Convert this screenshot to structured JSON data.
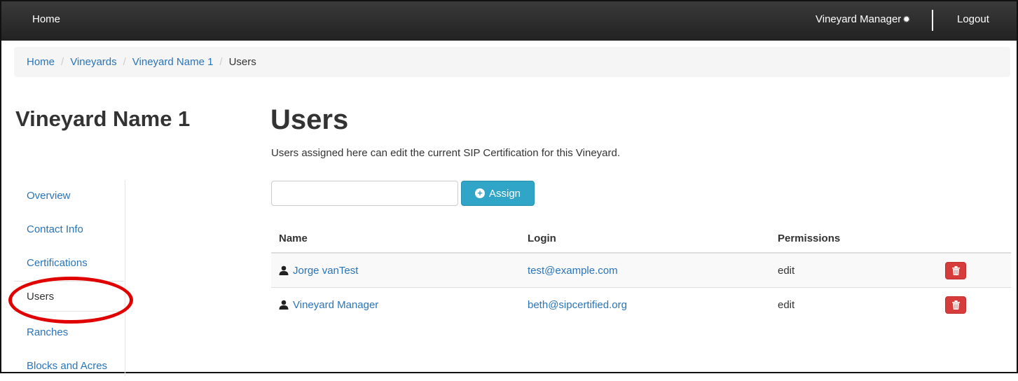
{
  "topbar": {
    "home": "Home",
    "user_menu": "Vineyard Manager",
    "logout": "Logout"
  },
  "breadcrumb": [
    "Home",
    "Vineyards",
    "Vineyard Name 1",
    "Users"
  ],
  "sidebar": {
    "title": "Vineyard Name 1",
    "items": [
      "Overview",
      "Contact Info",
      "Certifications",
      "Users",
      "Ranches",
      "Blocks and Acres"
    ],
    "active": "Users"
  },
  "main": {
    "title": "Users",
    "description": "Users assigned here can edit the current SIP Certification for this Vineyard.",
    "assign": {
      "value": "",
      "placeholder": "",
      "button": "Assign"
    },
    "table": {
      "headers": [
        "Name",
        "Login",
        "Permissions"
      ],
      "rows": [
        {
          "name": "Jorge vanTest",
          "login": "test@example.com",
          "permission": "edit"
        },
        {
          "name": "Vineyard Manager",
          "login": "beth@sipcertified.org",
          "permission": "edit"
        }
      ]
    }
  },
  "colors": {
    "link": "#2a74b9",
    "assign_button": "#31a5c8",
    "delete_button": "#d63c3c",
    "highlight_circle": "#e00000"
  }
}
